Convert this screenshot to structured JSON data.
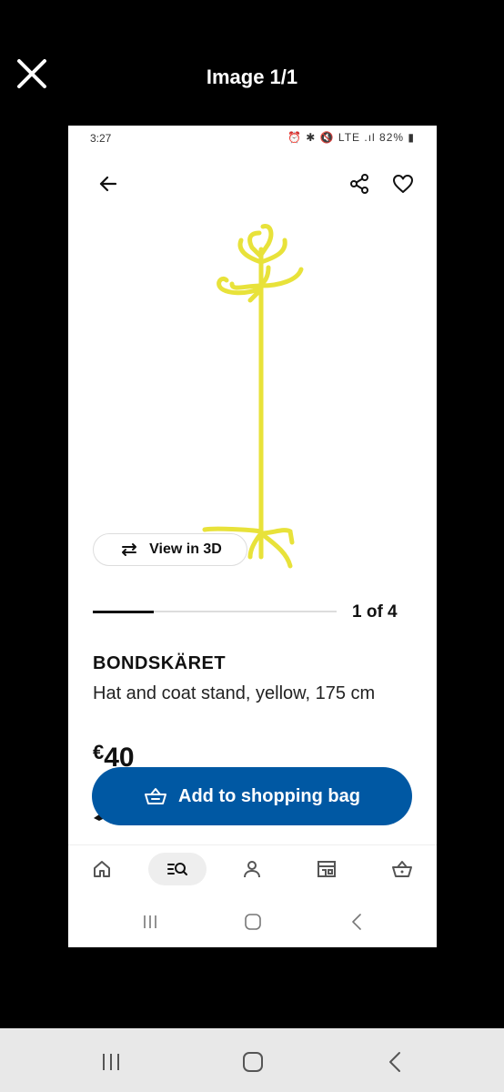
{
  "viewer": {
    "title": "Image 1/1",
    "close_icon": "close-icon"
  },
  "status_bar": {
    "time": "3:27",
    "icons_text": "⏰ ✱ 🔇 LTE .ıl 82% ▮"
  },
  "top_bar": {
    "back_icon": "arrow-left-icon",
    "share_icon": "share-icon",
    "favorite_icon": "heart-icon"
  },
  "product": {
    "image_description_icon": "coat-stand-image",
    "view_3d_label": "View in 3D",
    "carousel": {
      "counter_text": "1 of 4",
      "progress_fraction": 0.25
    },
    "name": "BONDSKÄRET",
    "description": "Hat and coat stand, yellow, 175 cm",
    "price_currency": "€",
    "price_value": "40"
  },
  "add_to_bag": {
    "label": "Add to shopping bag",
    "icon": "basket-icon"
  },
  "bottom_nav": {
    "items": [
      {
        "name": "home",
        "icon": "home-icon",
        "active": false
      },
      {
        "name": "search",
        "icon": "search-icon",
        "active": true
      },
      {
        "name": "profile",
        "icon": "person-icon",
        "active": false
      },
      {
        "name": "stores",
        "icon": "store-icon",
        "active": false
      },
      {
        "name": "bag",
        "icon": "basket-icon",
        "active": false
      }
    ]
  },
  "colors": {
    "primary_blue": "#0058a3",
    "product_yellow": "#e8e23a",
    "frame_black": "#000000"
  }
}
